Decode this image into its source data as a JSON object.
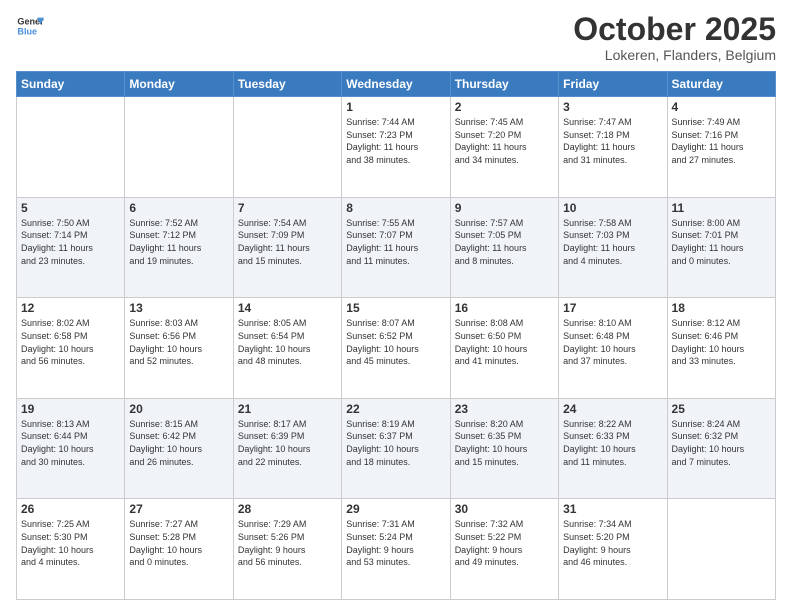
{
  "logo": {
    "line1": "General",
    "line2": "Blue"
  },
  "title": "October 2025",
  "location": "Lokeren, Flanders, Belgium",
  "headers": [
    "Sunday",
    "Monday",
    "Tuesday",
    "Wednesday",
    "Thursday",
    "Friday",
    "Saturday"
  ],
  "weeks": [
    [
      {
        "day": "",
        "info": ""
      },
      {
        "day": "",
        "info": ""
      },
      {
        "day": "",
        "info": ""
      },
      {
        "day": "1",
        "info": "Sunrise: 7:44 AM\nSunset: 7:23 PM\nDaylight: 11 hours\nand 38 minutes."
      },
      {
        "day": "2",
        "info": "Sunrise: 7:45 AM\nSunset: 7:20 PM\nDaylight: 11 hours\nand 34 minutes."
      },
      {
        "day": "3",
        "info": "Sunrise: 7:47 AM\nSunset: 7:18 PM\nDaylight: 11 hours\nand 31 minutes."
      },
      {
        "day": "4",
        "info": "Sunrise: 7:49 AM\nSunset: 7:16 PM\nDaylight: 11 hours\nand 27 minutes."
      }
    ],
    [
      {
        "day": "5",
        "info": "Sunrise: 7:50 AM\nSunset: 7:14 PM\nDaylight: 11 hours\nand 23 minutes."
      },
      {
        "day": "6",
        "info": "Sunrise: 7:52 AM\nSunset: 7:12 PM\nDaylight: 11 hours\nand 19 minutes."
      },
      {
        "day": "7",
        "info": "Sunrise: 7:54 AM\nSunset: 7:09 PM\nDaylight: 11 hours\nand 15 minutes."
      },
      {
        "day": "8",
        "info": "Sunrise: 7:55 AM\nSunset: 7:07 PM\nDaylight: 11 hours\nand 11 minutes."
      },
      {
        "day": "9",
        "info": "Sunrise: 7:57 AM\nSunset: 7:05 PM\nDaylight: 11 hours\nand 8 minutes."
      },
      {
        "day": "10",
        "info": "Sunrise: 7:58 AM\nSunset: 7:03 PM\nDaylight: 11 hours\nand 4 minutes."
      },
      {
        "day": "11",
        "info": "Sunrise: 8:00 AM\nSunset: 7:01 PM\nDaylight: 11 hours\nand 0 minutes."
      }
    ],
    [
      {
        "day": "12",
        "info": "Sunrise: 8:02 AM\nSunset: 6:58 PM\nDaylight: 10 hours\nand 56 minutes."
      },
      {
        "day": "13",
        "info": "Sunrise: 8:03 AM\nSunset: 6:56 PM\nDaylight: 10 hours\nand 52 minutes."
      },
      {
        "day": "14",
        "info": "Sunrise: 8:05 AM\nSunset: 6:54 PM\nDaylight: 10 hours\nand 48 minutes."
      },
      {
        "day": "15",
        "info": "Sunrise: 8:07 AM\nSunset: 6:52 PM\nDaylight: 10 hours\nand 45 minutes."
      },
      {
        "day": "16",
        "info": "Sunrise: 8:08 AM\nSunset: 6:50 PM\nDaylight: 10 hours\nand 41 minutes."
      },
      {
        "day": "17",
        "info": "Sunrise: 8:10 AM\nSunset: 6:48 PM\nDaylight: 10 hours\nand 37 minutes."
      },
      {
        "day": "18",
        "info": "Sunrise: 8:12 AM\nSunset: 6:46 PM\nDaylight: 10 hours\nand 33 minutes."
      }
    ],
    [
      {
        "day": "19",
        "info": "Sunrise: 8:13 AM\nSunset: 6:44 PM\nDaylight: 10 hours\nand 30 minutes."
      },
      {
        "day": "20",
        "info": "Sunrise: 8:15 AM\nSunset: 6:42 PM\nDaylight: 10 hours\nand 26 minutes."
      },
      {
        "day": "21",
        "info": "Sunrise: 8:17 AM\nSunset: 6:39 PM\nDaylight: 10 hours\nand 22 minutes."
      },
      {
        "day": "22",
        "info": "Sunrise: 8:19 AM\nSunset: 6:37 PM\nDaylight: 10 hours\nand 18 minutes."
      },
      {
        "day": "23",
        "info": "Sunrise: 8:20 AM\nSunset: 6:35 PM\nDaylight: 10 hours\nand 15 minutes."
      },
      {
        "day": "24",
        "info": "Sunrise: 8:22 AM\nSunset: 6:33 PM\nDaylight: 10 hours\nand 11 minutes."
      },
      {
        "day": "25",
        "info": "Sunrise: 8:24 AM\nSunset: 6:32 PM\nDaylight: 10 hours\nand 7 minutes."
      }
    ],
    [
      {
        "day": "26",
        "info": "Sunrise: 7:25 AM\nSunset: 5:30 PM\nDaylight: 10 hours\nand 4 minutes."
      },
      {
        "day": "27",
        "info": "Sunrise: 7:27 AM\nSunset: 5:28 PM\nDaylight: 10 hours\nand 0 minutes."
      },
      {
        "day": "28",
        "info": "Sunrise: 7:29 AM\nSunset: 5:26 PM\nDaylight: 9 hours\nand 56 minutes."
      },
      {
        "day": "29",
        "info": "Sunrise: 7:31 AM\nSunset: 5:24 PM\nDaylight: 9 hours\nand 53 minutes."
      },
      {
        "day": "30",
        "info": "Sunrise: 7:32 AM\nSunset: 5:22 PM\nDaylight: 9 hours\nand 49 minutes."
      },
      {
        "day": "31",
        "info": "Sunrise: 7:34 AM\nSunset: 5:20 PM\nDaylight: 9 hours\nand 46 minutes."
      },
      {
        "day": "",
        "info": ""
      }
    ]
  ]
}
